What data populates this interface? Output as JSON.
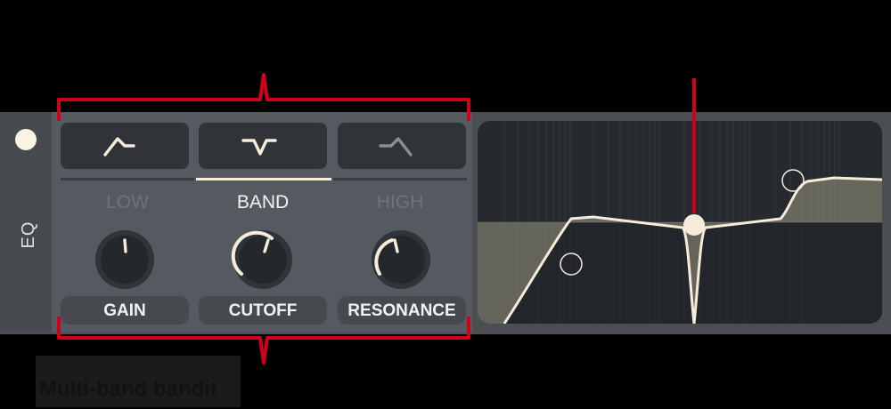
{
  "sidebar": {
    "label": "EQ"
  },
  "filter_buttons": [
    {
      "icon": "low-shelf-icon",
      "active": false
    },
    {
      "icon": "band-notch-icon",
      "active": true
    },
    {
      "icon": "high-shelf-icon",
      "active": false
    }
  ],
  "bands": [
    {
      "label": "LOW",
      "active": false
    },
    {
      "label": "BAND",
      "active": true
    },
    {
      "label": "HIGH",
      "active": false
    }
  ],
  "params": [
    {
      "label": "GAIN",
      "value": 0.52
    },
    {
      "label": "CUTOFF",
      "value": 0.65
    },
    {
      "label": "RESONANCE",
      "value": 0.45
    }
  ],
  "caption": "Multi-band bandit",
  "colors": {
    "accent": "#f6ecda",
    "callout": "#d0021b",
    "panel": "#555a60",
    "button": "#303438",
    "display": "#25292c"
  }
}
